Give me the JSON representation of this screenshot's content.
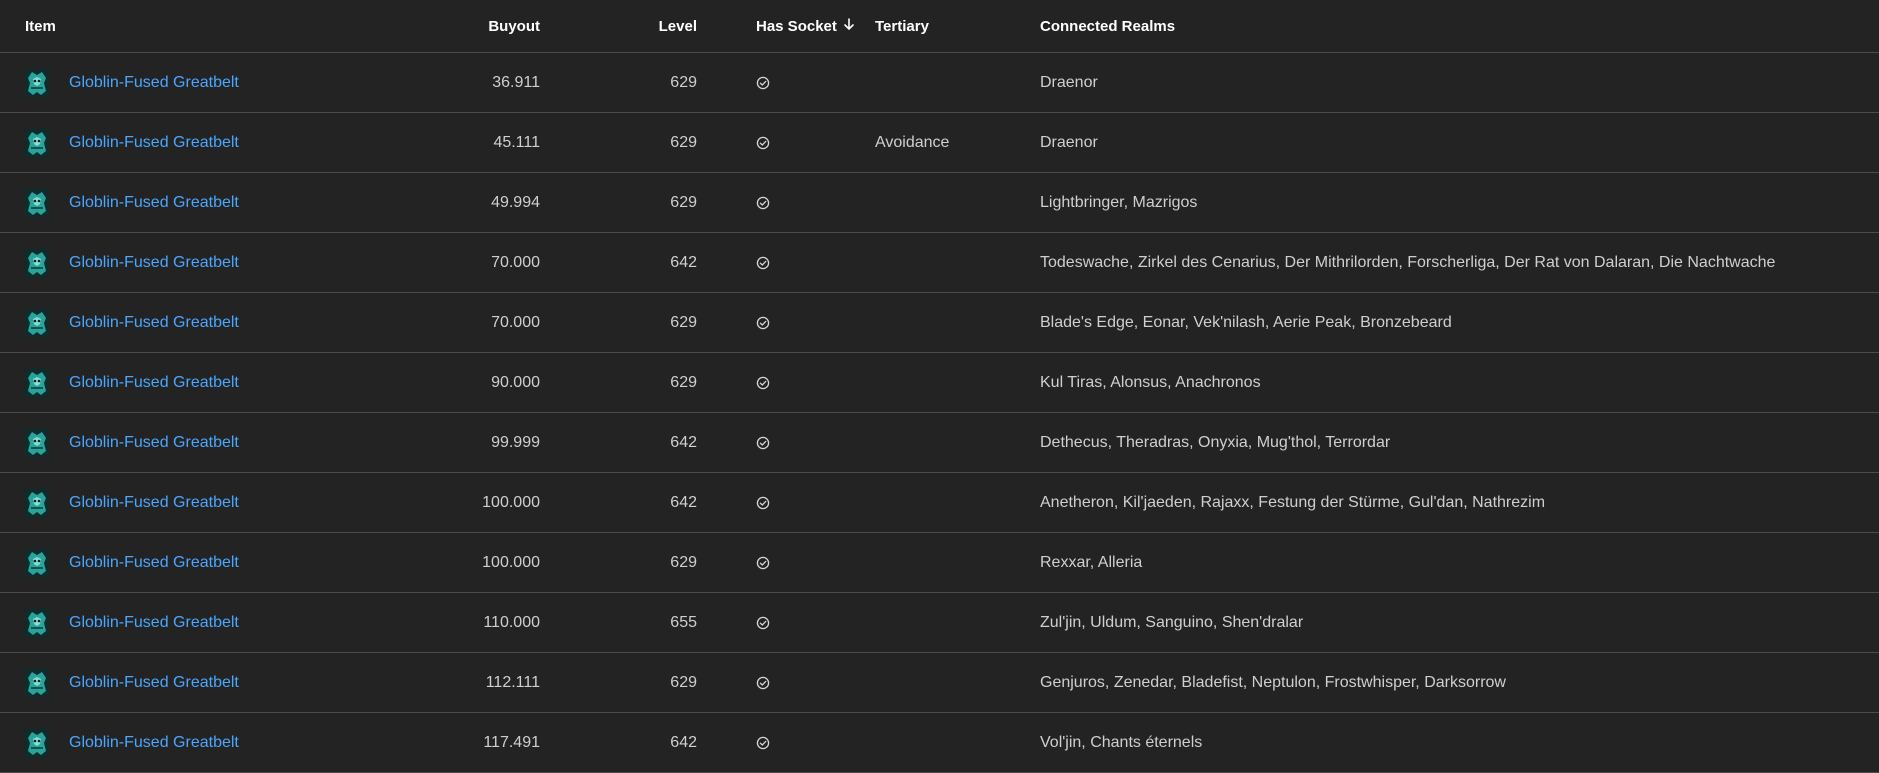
{
  "columns": {
    "item": "Item",
    "buyout": "Buyout",
    "level": "Level",
    "has_socket": "Has Socket",
    "tertiary": "Tertiary",
    "connected_realms": "Connected Realms"
  },
  "sort": {
    "column": "has_socket",
    "direction": "descending",
    "icon": "arrow-down-icon"
  },
  "colors": {
    "background": "#232323",
    "link": "#4aa6ff",
    "divider": "#4a4a4a"
  },
  "rows": [
    {
      "item": "Globlin-Fused Greatbelt",
      "buyout": "36.911",
      "level": "629",
      "has_socket": true,
      "tertiary": "",
      "realms": "Draenor"
    },
    {
      "item": "Globlin-Fused Greatbelt",
      "buyout": "45.111",
      "level": "629",
      "has_socket": true,
      "tertiary": "Avoidance",
      "realms": "Draenor"
    },
    {
      "item": "Globlin-Fused Greatbelt",
      "buyout": "49.994",
      "level": "629",
      "has_socket": true,
      "tertiary": "",
      "realms": "Lightbringer, Mazrigos"
    },
    {
      "item": "Globlin-Fused Greatbelt",
      "buyout": "70.000",
      "level": "642",
      "has_socket": true,
      "tertiary": "",
      "realms": "Todeswache, Zirkel des Cenarius, Der Mithrilorden, Forscherliga, Der Rat von Dalaran, Die Nachtwache"
    },
    {
      "item": "Globlin-Fused Greatbelt",
      "buyout": "70.000",
      "level": "629",
      "has_socket": true,
      "tertiary": "",
      "realms": "Blade's Edge, Eonar, Vek'nilash, Aerie Peak, Bronzebeard"
    },
    {
      "item": "Globlin-Fused Greatbelt",
      "buyout": "90.000",
      "level": "629",
      "has_socket": true,
      "tertiary": "",
      "realms": "Kul Tiras, Alonsus, Anachronos"
    },
    {
      "item": "Globlin-Fused Greatbelt",
      "buyout": "99.999",
      "level": "642",
      "has_socket": true,
      "tertiary": "",
      "realms": "Dethecus, Theradras, Onyxia, Mug'thol, Terrordar"
    },
    {
      "item": "Globlin-Fused Greatbelt",
      "buyout": "100.000",
      "level": "642",
      "has_socket": true,
      "tertiary": "",
      "realms": "Anetheron, Kil'jaeden, Rajaxx, Festung der Stürme, Gul'dan, Nathrezim"
    },
    {
      "item": "Globlin-Fused Greatbelt",
      "buyout": "100.000",
      "level": "629",
      "has_socket": true,
      "tertiary": "",
      "realms": "Rexxar, Alleria"
    },
    {
      "item": "Globlin-Fused Greatbelt",
      "buyout": "110.000",
      "level": "655",
      "has_socket": true,
      "tertiary": "",
      "realms": "Zul'jin, Uldum, Sanguino, Shen'dralar"
    },
    {
      "item": "Globlin-Fused Greatbelt",
      "buyout": "112.111",
      "level": "629",
      "has_socket": true,
      "tertiary": "",
      "realms": "Genjuros, Zenedar, Bladefist, Neptulon, Frostwhisper, Darksorrow"
    },
    {
      "item": "Globlin-Fused Greatbelt",
      "buyout": "117.491",
      "level": "642",
      "has_socket": true,
      "tertiary": "",
      "realms": "Vol'jin, Chants éternels"
    }
  ]
}
